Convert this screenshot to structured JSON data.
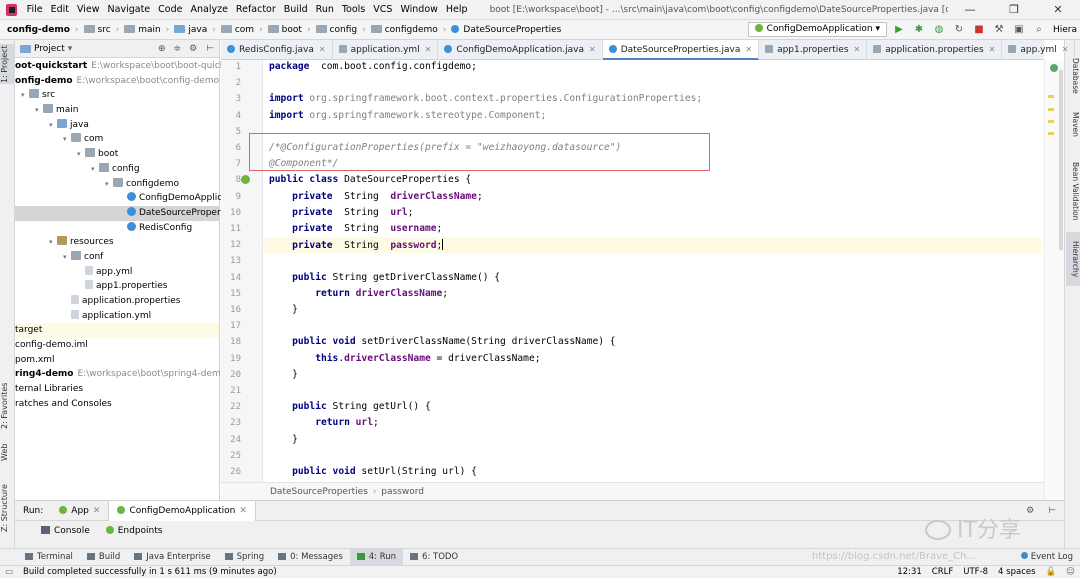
{
  "window": {
    "menus": [
      "File",
      "Edit",
      "View",
      "Navigate",
      "Code",
      "Analyze",
      "Refactor",
      "Build",
      "Run",
      "Tools",
      "VCS",
      "Window",
      "Help"
    ],
    "title": "boot [E:\\workspace\\boot] - ...\\src\\main\\java\\com\\boot\\config\\configdemo\\DateSourceProperties.java [config-demo]",
    "controls": [
      "—",
      "❐",
      "✕"
    ]
  },
  "navbar": {
    "crumbs": [
      "config-demo",
      "src",
      "main",
      "java",
      "com",
      "boot",
      "config",
      "configdemo",
      "DateSourceProperties"
    ],
    "run_config": "ConfigDemoApplication",
    "right_label": "Hiera"
  },
  "leftstripe": {
    "tabs": [
      "1: Project",
      "2: Favorites",
      "Web",
      "Z: Structure"
    ]
  },
  "rightstripe": {
    "tabs": [
      "Database",
      "Maven",
      "Bean Validation",
      "Hierarchy"
    ]
  },
  "project": {
    "header": "Project",
    "tree": [
      {
        "label": "oot-quickstart",
        "extra": "E:\\workspace\\boot\\boot-quickstart",
        "indent": 0,
        "icon": "",
        "bold": true
      },
      {
        "label": "onfig-demo",
        "extra": "E:\\workspace\\boot\\config-demo",
        "indent": 0,
        "icon": "",
        "bold": true
      },
      {
        "label": "src",
        "extra": "",
        "indent": 0,
        "icon": "folder-ic",
        "tw": "▾"
      },
      {
        "label": "main",
        "extra": "",
        "indent": 1,
        "icon": "folder-ic",
        "tw": "▾"
      },
      {
        "label": "java",
        "extra": "",
        "indent": 2,
        "icon": "src-ic",
        "tw": "▾"
      },
      {
        "label": "com",
        "extra": "",
        "indent": 3,
        "icon": "folder-ic",
        "tw": "▾"
      },
      {
        "label": "boot",
        "extra": "",
        "indent": 4,
        "icon": "folder-ic",
        "tw": "▾"
      },
      {
        "label": "config",
        "extra": "",
        "indent": 5,
        "icon": "folder-ic",
        "tw": "▾"
      },
      {
        "label": "configdemo",
        "extra": "",
        "indent": 6,
        "icon": "folder-ic",
        "tw": "▾"
      },
      {
        "label": "ConfigDemoApplication",
        "extra": "",
        "indent": 7,
        "icon": "class-ic"
      },
      {
        "label": "DateSourceProperties",
        "extra": "",
        "indent": 7,
        "icon": "class-ic",
        "selected": true
      },
      {
        "label": "RedisConfig",
        "extra": "",
        "indent": 7,
        "icon": "class-ic"
      },
      {
        "label": "resources",
        "extra": "",
        "indent": 2,
        "icon": "res-ic",
        "tw": "▾"
      },
      {
        "label": "conf",
        "extra": "",
        "indent": 3,
        "icon": "folder-ic",
        "tw": "▾"
      },
      {
        "label": "app.yml",
        "extra": "",
        "indent": 4,
        "icon": "file-ic"
      },
      {
        "label": "app1.properties",
        "extra": "",
        "indent": 4,
        "icon": "file-ic"
      },
      {
        "label": "application.properties",
        "extra": "",
        "indent": 3,
        "icon": "file-ic"
      },
      {
        "label": "application.yml",
        "extra": "",
        "indent": 3,
        "icon": "file-ic"
      },
      {
        "label": "target",
        "extra": "",
        "indent": 0,
        "icon": "",
        "yellow": true
      },
      {
        "label": "config-demo.iml",
        "extra": "",
        "indent": 0,
        "icon": ""
      },
      {
        "label": "pom.xml",
        "extra": "",
        "indent": 0,
        "icon": ""
      },
      {
        "label": "ring4-demo",
        "extra": "E:\\workspace\\boot\\spring4-demo",
        "indent": 0,
        "icon": "",
        "bold": true
      },
      {
        "label": "ternal Libraries",
        "extra": "",
        "indent": 0,
        "icon": ""
      },
      {
        "label": "ratches and Consoles",
        "extra": "",
        "indent": 0,
        "icon": ""
      }
    ]
  },
  "tabs": [
    {
      "label": "RedisConfig.java",
      "icon": "class"
    },
    {
      "label": "application.yml",
      "icon": "yml"
    },
    {
      "label": "ConfigDemoApplication.java",
      "icon": "class"
    },
    {
      "label": "DateSourceProperties.java",
      "icon": "class",
      "active": true
    },
    {
      "label": "app1.properties",
      "icon": "yml"
    },
    {
      "label": "application.properties",
      "icon": "yml"
    },
    {
      "label": "app.yml",
      "icon": "yml"
    }
  ],
  "code": {
    "line_numbers": [
      "1",
      "2",
      "3",
      "4",
      "5",
      "6",
      "7",
      "8",
      "9",
      "10",
      "11",
      "12",
      "13",
      "14",
      "15",
      "16",
      "17",
      "18",
      "19",
      "20",
      "21",
      "22",
      "23",
      "24",
      "25",
      "26"
    ],
    "lines": [
      [
        [
          "kw",
          "package"
        ],
        [
          "",
          "  com.boot.config.configdemo;"
        ]
      ],
      [],
      [
        [
          "kw",
          "import"
        ],
        [
          "pkg",
          " org.springframework.boot.context.properties.ConfigurationProperties;"
        ]
      ],
      [
        [
          "kw",
          "import"
        ],
        [
          "pkg",
          " org.springframework.stereotype.Component;"
        ]
      ],
      [],
      [
        [
          "cm",
          "/*@ConfigurationProperties(prefix = \"weizhaoyong.datasource\")"
        ]
      ],
      [
        [
          "cm",
          "@Component*/"
        ]
      ],
      [
        [
          "kw",
          "public class"
        ],
        [
          "",
          " DateSourceProperties {"
        ]
      ],
      [
        [
          "",
          "    "
        ],
        [
          "kw",
          "private"
        ],
        [
          "",
          "  String  "
        ],
        [
          "fd",
          "driverClassName"
        ],
        [
          "",
          ";"
        ]
      ],
      [
        [
          "",
          "    "
        ],
        [
          "kw",
          "private"
        ],
        [
          "",
          "  String  "
        ],
        [
          "fd",
          "url"
        ],
        [
          "",
          ";"
        ]
      ],
      [
        [
          "",
          "    "
        ],
        [
          "kw",
          "private"
        ],
        [
          "",
          "  String  "
        ],
        [
          "fd",
          "username"
        ],
        [
          "",
          ";"
        ]
      ],
      [
        [
          "",
          "    "
        ],
        [
          "kw",
          "private"
        ],
        [
          "",
          "  String  "
        ],
        [
          "fd",
          "password"
        ],
        [
          "",
          ";"
        ],
        [
          "cur",
          ""
        ]
      ],
      [],
      [
        [
          "",
          "    "
        ],
        [
          "kw",
          "public"
        ],
        [
          "",
          " String getDriverClassName() {"
        ]
      ],
      [
        [
          "",
          "        "
        ],
        [
          "kw",
          "return"
        ],
        [
          "",
          ""
        ],
        [
          "fd",
          " driverClassName"
        ],
        [
          "",
          ";"
        ]
      ],
      [
        [
          "",
          "    }"
        ]
      ],
      [],
      [
        [
          "",
          "    "
        ],
        [
          "kw",
          "public void"
        ],
        [
          "",
          " setDriverClassName(String driverClassName) {"
        ]
      ],
      [
        [
          "",
          "        "
        ],
        [
          "kw",
          "this"
        ],
        [
          "",
          "."
        ],
        [
          "fd",
          "driverClassName"
        ],
        [
          "",
          " = driverClassName;"
        ]
      ],
      [
        [
          "",
          "    }"
        ]
      ],
      [],
      [
        [
          "",
          "    "
        ],
        [
          "kw",
          "public"
        ],
        [
          "",
          " String getUrl() {"
        ]
      ],
      [
        [
          "",
          "        "
        ],
        [
          "kw",
          "return"
        ],
        [
          "fd",
          " url"
        ],
        [
          "",
          ";"
        ]
      ],
      [
        [
          "",
          "    }"
        ]
      ],
      [],
      [
        [
          "",
          "    "
        ],
        [
          "kw",
          "public void"
        ],
        [
          "",
          " setUrl(String url) {"
        ]
      ]
    ]
  },
  "editor_crumbs": [
    "DateSourceProperties",
    "password"
  ],
  "run": {
    "label": "Run:",
    "tabs": [
      "App",
      "ConfigDemoApplication"
    ],
    "subtabs": [
      "Console",
      "Endpoints"
    ]
  },
  "tooltabs": [
    {
      "label": "Terminal"
    },
    {
      "label": "Build"
    },
    {
      "label": "Java Enterprise"
    },
    {
      "label": "Spring"
    },
    {
      "label": "0: Messages"
    },
    {
      "label": "4: Run",
      "active": true
    },
    {
      "label": "6: TODO"
    }
  ],
  "event_log": "Event Log",
  "status": {
    "message": "Build completed successfully in 1 s 611 ms (9 minutes ago)",
    "position": "12:31",
    "line_sep": "CRLF",
    "encoding": "UTF-8",
    "indent": "4 spaces"
  },
  "watermark": {
    "brand": "IT分享",
    "url": "https://blog.csdn.net/Brave_Ch..."
  }
}
